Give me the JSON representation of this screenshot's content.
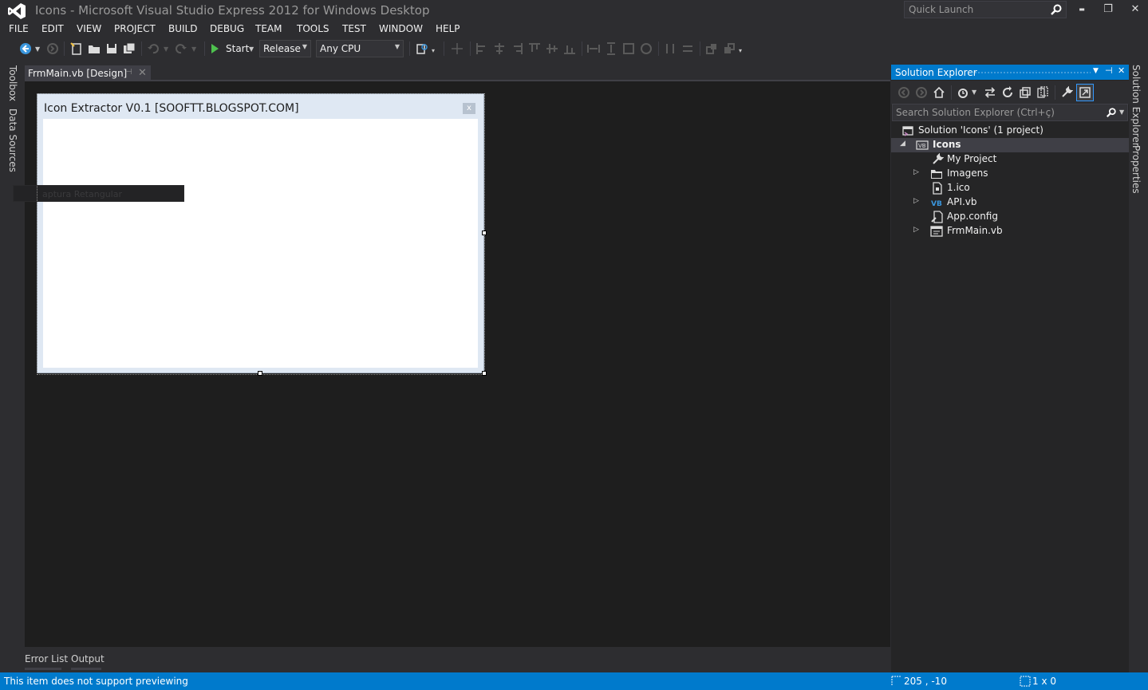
{
  "window": {
    "title": "Icons - Microsoft Visual Studio Express 2012 for Windows Desktop",
    "quick_launch_placeholder": "Quick Launch",
    "minimize": "▬",
    "restore": "❐",
    "close": "✕"
  },
  "menu": {
    "items": [
      "FILE",
      "EDIT",
      "VIEW",
      "PROJECT",
      "BUILD",
      "DEBUG",
      "TEAM",
      "TOOLS",
      "TEST",
      "WINDOW",
      "HELP"
    ]
  },
  "toolbar": {
    "start_label": "Start",
    "configuration": "Release",
    "platform": "Any CPU"
  },
  "left_tabs": [
    "Toolbox",
    "Data Sources"
  ],
  "document_tab": {
    "label": "FrmMain.vb [Design]",
    "pin": "⊣",
    "close": "✕"
  },
  "designer": {
    "form_title": "Icon Extractor V0.1 [SOOFTT.BLOGSPOT.COM]",
    "form_close": "x",
    "ghost_item": "aptura Retangular"
  },
  "bottom_tabs": [
    "Error List",
    "Output"
  ],
  "solution_explorer": {
    "title": "Solution Explorer",
    "search_placeholder": "Search Solution Explorer (Ctrl+ç)",
    "tree": [
      {
        "label": "Solution 'Icons' (1 project)",
        "icon": "solution-icon",
        "arrow": ""
      },
      {
        "label": "Icons",
        "icon": "vb-project-icon",
        "arrow": "◢",
        "selected": true,
        "bold": true
      },
      {
        "label": "My Project",
        "icon": "wrench-icon",
        "arrow": ""
      },
      {
        "label": "Imagens",
        "icon": "folder-icon",
        "arrow": "▷"
      },
      {
        "label": "1.ico",
        "icon": "ico-file-icon",
        "arrow": ""
      },
      {
        "label": "API.vb",
        "icon": "vb-file-icon",
        "arrow": "▷"
      },
      {
        "label": "App.config",
        "icon": "config-file-icon",
        "arrow": ""
      },
      {
        "label": "FrmMain.vb",
        "icon": "form-file-icon",
        "arrow": "▷"
      }
    ]
  },
  "right_tabs": [
    "Solution Explorer",
    "Properties"
  ],
  "status": {
    "message": "This item does not support previewing",
    "position": "205 , -10",
    "size": "1 x 0"
  },
  "colors": {
    "accent": "#007acc",
    "background": "#2d2d30",
    "designer_bg": "#1e1e1e",
    "panel_bg": "#252526"
  }
}
